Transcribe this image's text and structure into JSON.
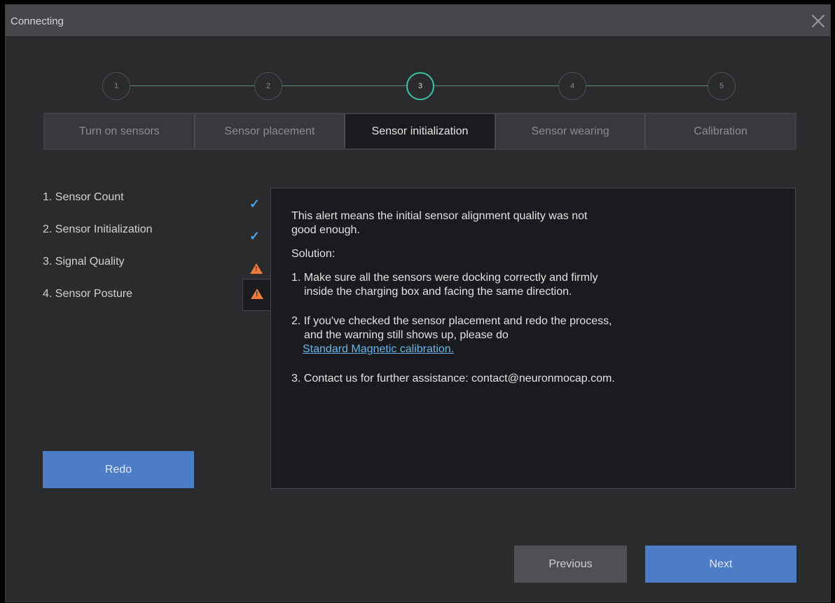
{
  "window": {
    "title": "Connecting"
  },
  "steps": [
    "1",
    "2",
    "3",
    "4",
    "5"
  ],
  "tabs": [
    "Turn on sensors",
    "Sensor placement",
    "Sensor initialization",
    "Sensor wearing",
    "Calibration"
  ],
  "active_tab": "Sensor initialization",
  "checks": [
    {
      "label": "1. Sensor Count",
      "status": "check"
    },
    {
      "label": "2. Sensor Initialization",
      "status": "check"
    },
    {
      "label": "3. Signal Quality",
      "status": "warning"
    },
    {
      "label": "4. Sensor Posture",
      "status": "warning"
    }
  ],
  "detail": {
    "intro_1": "This alert means the initial sensor alignment quality was not",
    "intro_2": "good enough.",
    "solution": "Solution:",
    "step1_a": "1. Make sure all the sensors were docking correctly and firmly",
    "step1_b": "inside the charging box and facing the same direction.",
    "step2_a": "2. If you've checked the sensor placement and redo the process,",
    "step2_b": "and the warning still shows up, please do",
    "step2_link": "Standard Magnetic calibration.",
    "step3": "3. Contact us for further assistance: contact@neuronmocap.com."
  },
  "buttons": {
    "redo": "Redo",
    "previous": "Previous",
    "next": "Next"
  },
  "colors": {
    "accent_blue": "#4d7ec5",
    "step_active": "#3fc199",
    "warning": "#ee7a3c",
    "check": "#4aa3e8"
  }
}
